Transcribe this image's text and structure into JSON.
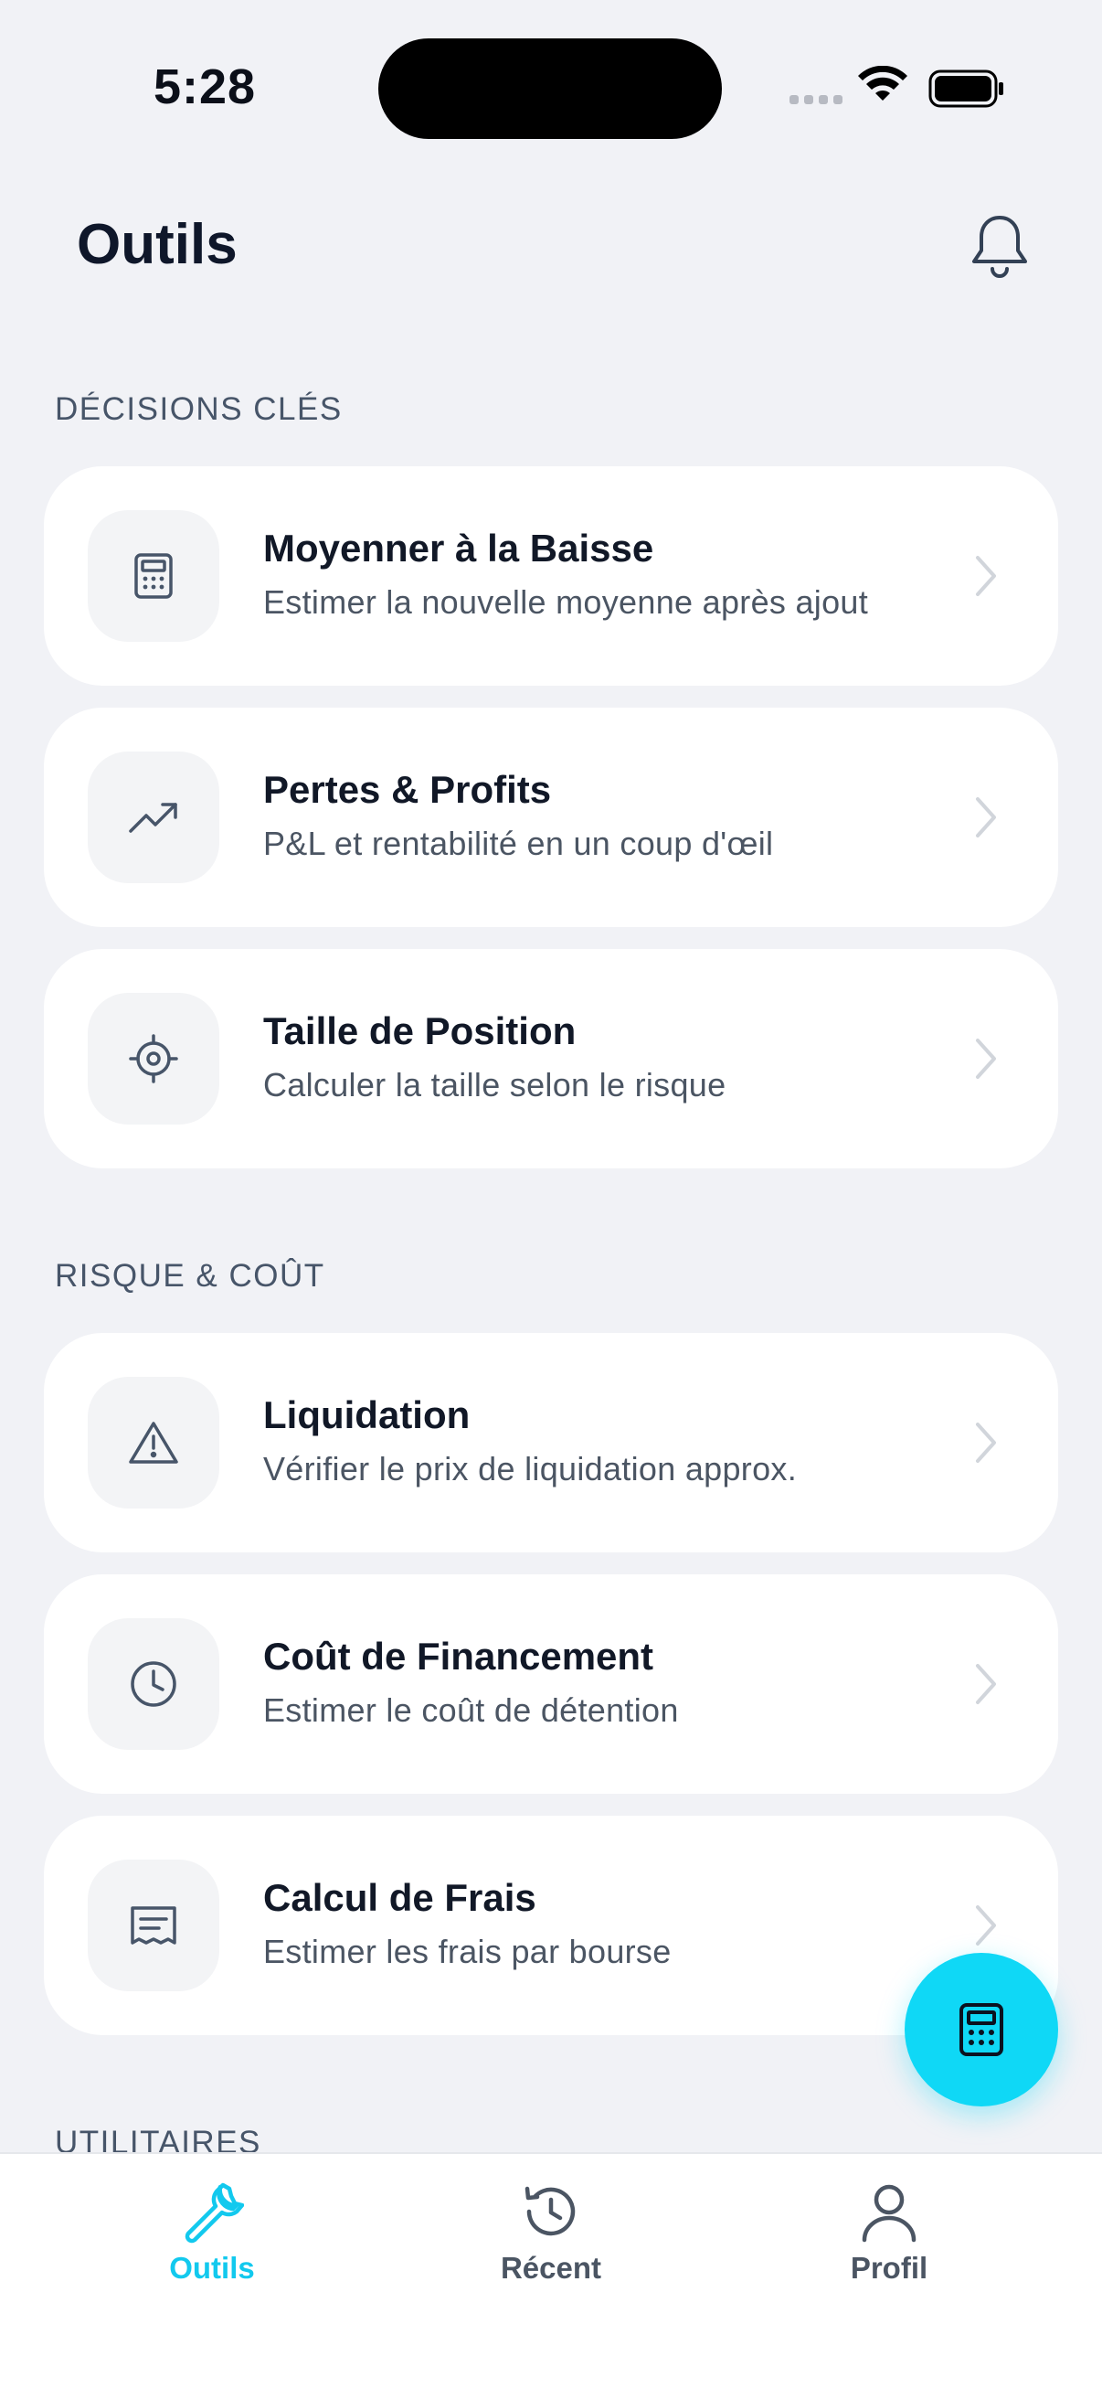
{
  "status_bar": {
    "time": "5:28"
  },
  "header": {
    "title": "Outils"
  },
  "sections": [
    {
      "label": "DÉCISIONS CLÉS",
      "items": [
        {
          "title": "Moyenner à la Baisse",
          "subtitle": "Estimer la nouvelle moyenne après ajout",
          "icon": "calculator-icon"
        },
        {
          "title": "Pertes & Profits",
          "subtitle": "P&L et rentabilité en un coup d'œil",
          "icon": "trending-up-icon"
        },
        {
          "title": "Taille de Position",
          "subtitle": "Calculer la taille selon le risque",
          "icon": "crosshair-icon"
        }
      ]
    },
    {
      "label": "RISQUE & COÛT",
      "items": [
        {
          "title": "Liquidation",
          "subtitle": "Vérifier le prix de liquidation approx.",
          "icon": "warning-icon"
        },
        {
          "title": "Coût de Financement",
          "subtitle": "Estimer le coût de détention",
          "icon": "clock-icon"
        },
        {
          "title": "Calcul de Frais",
          "subtitle": "Estimer les frais par bourse",
          "icon": "receipt-icon"
        }
      ]
    },
    {
      "label": "UTILITAIRES"
    }
  ],
  "bottom_nav": [
    {
      "label": "Outils",
      "icon": "wrench-icon",
      "active": true
    },
    {
      "label": "Récent",
      "icon": "history-icon",
      "active": false
    },
    {
      "label": "Profil",
      "icon": "user-icon",
      "active": false
    }
  ],
  "colors": {
    "accent": "#0fd8f6",
    "active_nav": "#12c9ee",
    "background": "#f1f2f6"
  }
}
